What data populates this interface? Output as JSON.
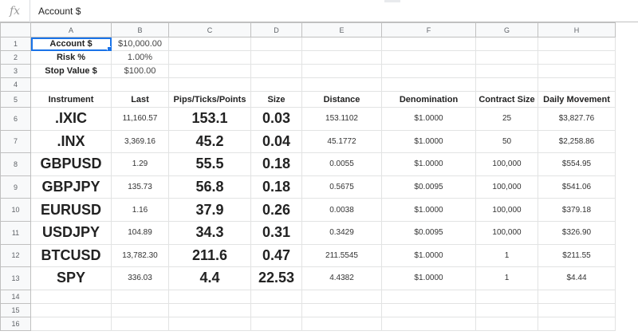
{
  "formula_bar": {
    "fx_label": "fx",
    "content": "Account $"
  },
  "columns": [
    "A",
    "B",
    "C",
    "D",
    "E",
    "F",
    "G",
    "H"
  ],
  "row_numbers": [
    "1",
    "2",
    "3",
    "4",
    "5",
    "6",
    "7",
    "8",
    "9",
    "10",
    "11",
    "12",
    "13",
    "14",
    "15",
    "16"
  ],
  "settings": [
    {
      "label": "Account $",
      "value": "$10,000.00"
    },
    {
      "label": "Risk %",
      "value": "1.00%"
    },
    {
      "label": "Stop Value $",
      "value": "$100.00"
    }
  ],
  "table_headers": [
    "Instrument",
    "Last",
    "Pips/Ticks/Points",
    "Size",
    "Distance",
    "Denomination",
    "Contract Size",
    "Daily Movement"
  ],
  "rows": [
    {
      "instrument": ".IXIC",
      "last": "11,160.57",
      "pips": "153.1",
      "size": "0.03",
      "distance": "153.1102",
      "denomination": "$1.0000",
      "contract": "25",
      "daily": "$3,827.76"
    },
    {
      "instrument": ".INX",
      "last": "3,369.16",
      "pips": "45.2",
      "size": "0.04",
      "distance": "45.1772",
      "denomination": "$1.0000",
      "contract": "50",
      "daily": "$2,258.86"
    },
    {
      "instrument": "GBPUSD",
      "last": "1.29",
      "pips": "55.5",
      "size": "0.18",
      "distance": "0.0055",
      "denomination": "$1.0000",
      "contract": "100,000",
      "daily": "$554.95"
    },
    {
      "instrument": "GBPJPY",
      "last": "135.73",
      "pips": "56.8",
      "size": "0.18",
      "distance": "0.5675",
      "denomination": "$0.0095",
      "contract": "100,000",
      "daily": "$541.06"
    },
    {
      "instrument": "EURUSD",
      "last": "1.16",
      "pips": "37.9",
      "size": "0.26",
      "distance": "0.0038",
      "denomination": "$1.0000",
      "contract": "100,000",
      "daily": "$379.18"
    },
    {
      "instrument": "USDJPY",
      "last": "104.89",
      "pips": "34.3",
      "size": "0.31",
      "distance": "0.3429",
      "denomination": "$0.0095",
      "contract": "100,000",
      "daily": "$326.90"
    },
    {
      "instrument": "BTCUSD",
      "last": "13,782.30",
      "pips": "211.6",
      "size": "0.47",
      "distance": "211.5545",
      "denomination": "$1.0000",
      "contract": "1",
      "daily": "$211.55"
    },
    {
      "instrument": "SPY",
      "last": "336.03",
      "pips": "4.4",
      "size": "22.53",
      "distance": "4.4382",
      "denomination": "$1.0000",
      "contract": "1",
      "daily": "$4.44"
    }
  ],
  "colors": {
    "selection": "#1a73e8",
    "header_bg": "#f8f9fa",
    "gridline": "#e2e3e3"
  }
}
